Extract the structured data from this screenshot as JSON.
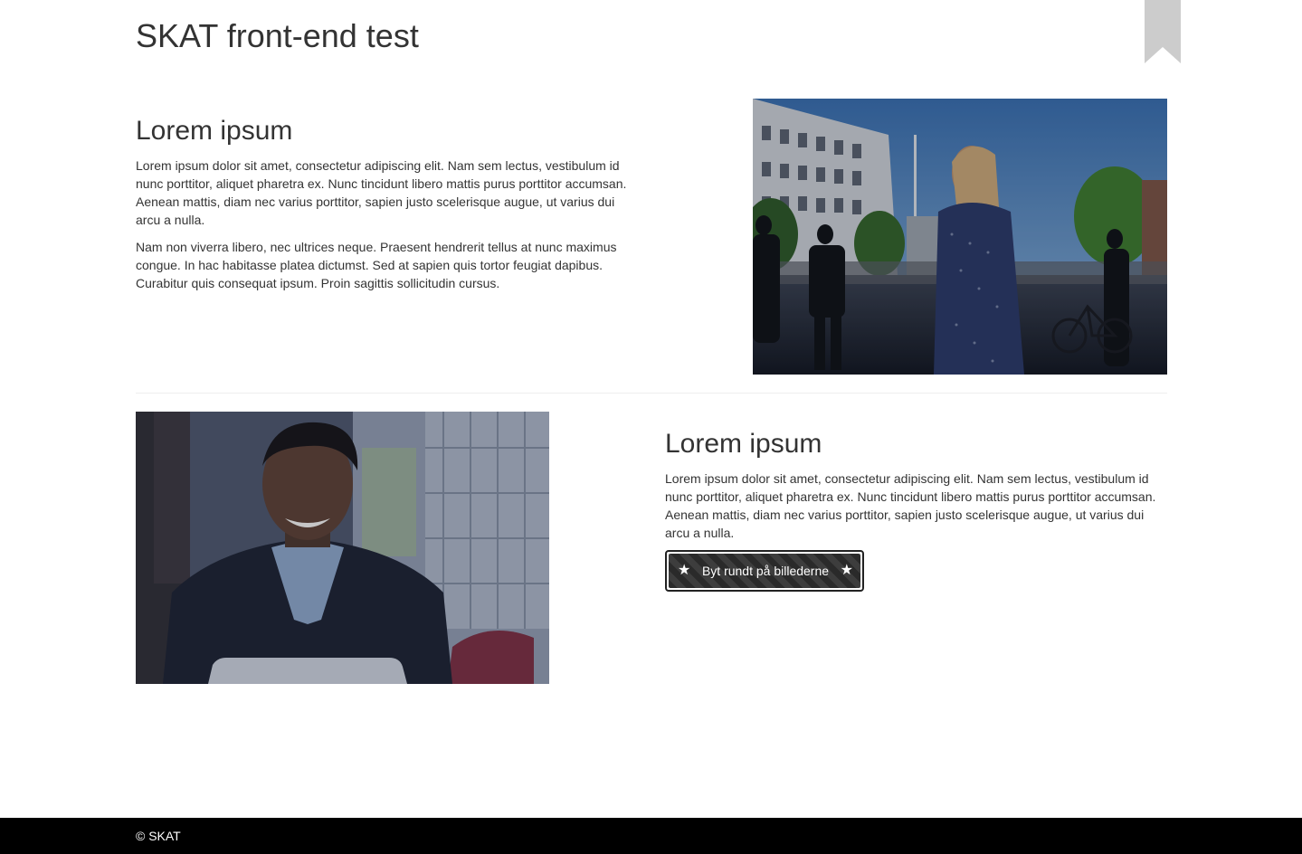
{
  "header": {
    "title": "SKAT front-end test",
    "bookmark_icon": "bookmark-ribbon-icon"
  },
  "section1": {
    "heading": "Lorem ipsum",
    "paragraph1": "Lorem ipsum dolor sit amet, consectetur adipiscing elit. Nam sem lectus, vestibulum id nunc porttitor, aliquet pharetra ex. Nunc tincidunt libero mattis purus porttitor accumsan. Aenean mattis, diam nec varius porttitor, sapien justo scelerisque augue, ut varius dui arcu a nulla.",
    "paragraph2": "Nam non viverra libero, nec ultrices neque. Praesent hendrerit tellus at nunc maximus congue. In hac habitasse platea dictumst. Sed at sapien quis tortor feugiat dapibus. Curabitur quis consequat ipsum. Proin sagittis sollicitudin cursus."
  },
  "section2": {
    "heading": "Lorem ipsum",
    "paragraph1": "Lorem ipsum dolor sit amet, consectetur adipiscing elit. Nam sem lectus, vestibulum id nunc porttitor, aliquet pharetra ex. Nunc tincidunt libero mattis purus porttitor accumsan. Aenean mattis, diam nec varius porttitor, sapien justo scelerisque augue, ut varius dui arcu a nulla.",
    "button_label": "Byt rundt på billederne",
    "button_icon": "star-icon"
  },
  "footer": {
    "copyright": "© SKAT"
  },
  "colors": {
    "text": "#333333",
    "footer_bg": "#000000",
    "bookmark": "#cccccc",
    "divider": "#eeeeee"
  }
}
